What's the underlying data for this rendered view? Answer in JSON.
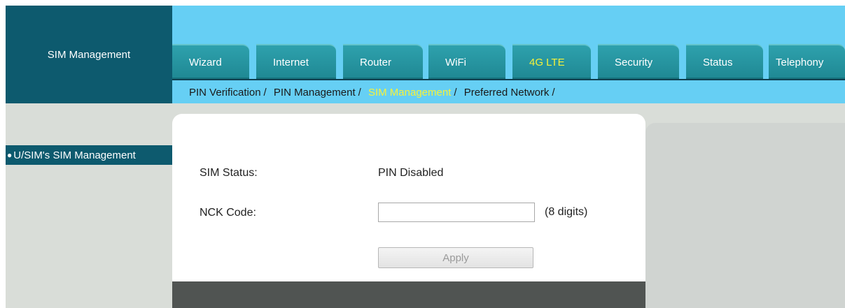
{
  "header": {
    "page_title": "SIM Management",
    "tabs": [
      {
        "label": "Wizard",
        "active": false
      },
      {
        "label": "Internet",
        "active": false
      },
      {
        "label": "Router",
        "active": false
      },
      {
        "label": "WiFi",
        "active": false
      },
      {
        "label": "4G LTE",
        "active": true
      },
      {
        "label": "Security",
        "active": false
      },
      {
        "label": "Status",
        "active": false
      },
      {
        "label": "Telephony",
        "active": false
      }
    ],
    "subnav": [
      {
        "label": "PIN Verification",
        "active": false
      },
      {
        "label": "PIN Management",
        "active": false
      },
      {
        "label": "SIM Management",
        "active": true
      },
      {
        "label": "Preferred Network",
        "active": false
      }
    ],
    "separator": "/"
  },
  "sidebar": {
    "items": [
      {
        "bullet": "●",
        "label": "U/SIM's SIM Management",
        "active": true
      }
    ]
  },
  "form": {
    "sim_status_label": "SIM Status:",
    "sim_status_value": "PIN Disabled",
    "nck_label": "NCK Code:",
    "nck_value": "",
    "nck_hint": "(8 digits)",
    "apply_label": "Apply"
  },
  "colors": {
    "header_blue": "#66cff4",
    "dark_teal": "#0d5a6e",
    "tab_teal": "#2ea1ad",
    "active_yellow": "#f5f23a"
  }
}
